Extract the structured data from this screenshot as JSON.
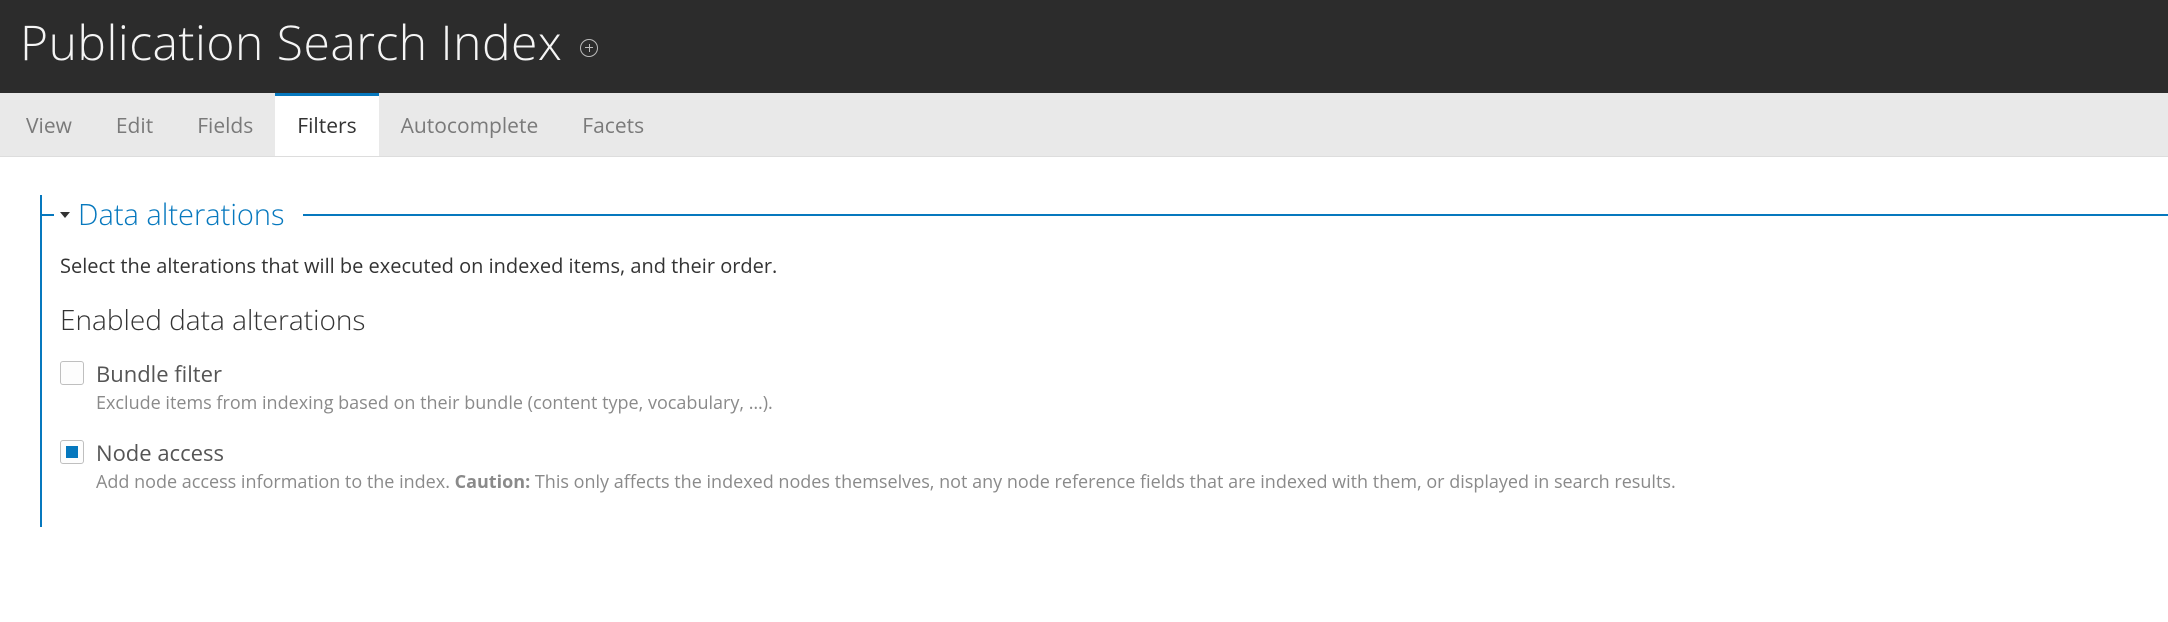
{
  "header": {
    "title": "Publication Search Index",
    "add_icon": "add-circle"
  },
  "tabs": [
    {
      "key": "view",
      "label": "View",
      "active": false
    },
    {
      "key": "edit",
      "label": "Edit",
      "active": false
    },
    {
      "key": "fields",
      "label": "Fields",
      "active": false
    },
    {
      "key": "filters",
      "label": "Filters",
      "active": true
    },
    {
      "key": "autocomplete",
      "label": "Autocomplete",
      "active": false
    },
    {
      "key": "facets",
      "label": "Facets",
      "active": false
    }
  ],
  "fieldset": {
    "legend": "Data alterations",
    "expanded": true,
    "description": "Select the alterations that will be executed on indexed items, and their order.",
    "section_title": "Enabled data alterations",
    "options": [
      {
        "key": "bundle-filter",
        "label": "Bundle filter",
        "checked": false,
        "help": "Exclude items from indexing based on their bundle (content type, vocabulary, …)."
      },
      {
        "key": "node-access",
        "label": "Node access",
        "checked": true,
        "help_prefix": "Add node access information to the index. ",
        "help_strong": "Caution:",
        "help_suffix": " This only affects the indexed nodes themselves, not any node reference fields that are indexed with them, or displayed in search results."
      }
    ]
  },
  "colors": {
    "accent": "#0678be"
  }
}
